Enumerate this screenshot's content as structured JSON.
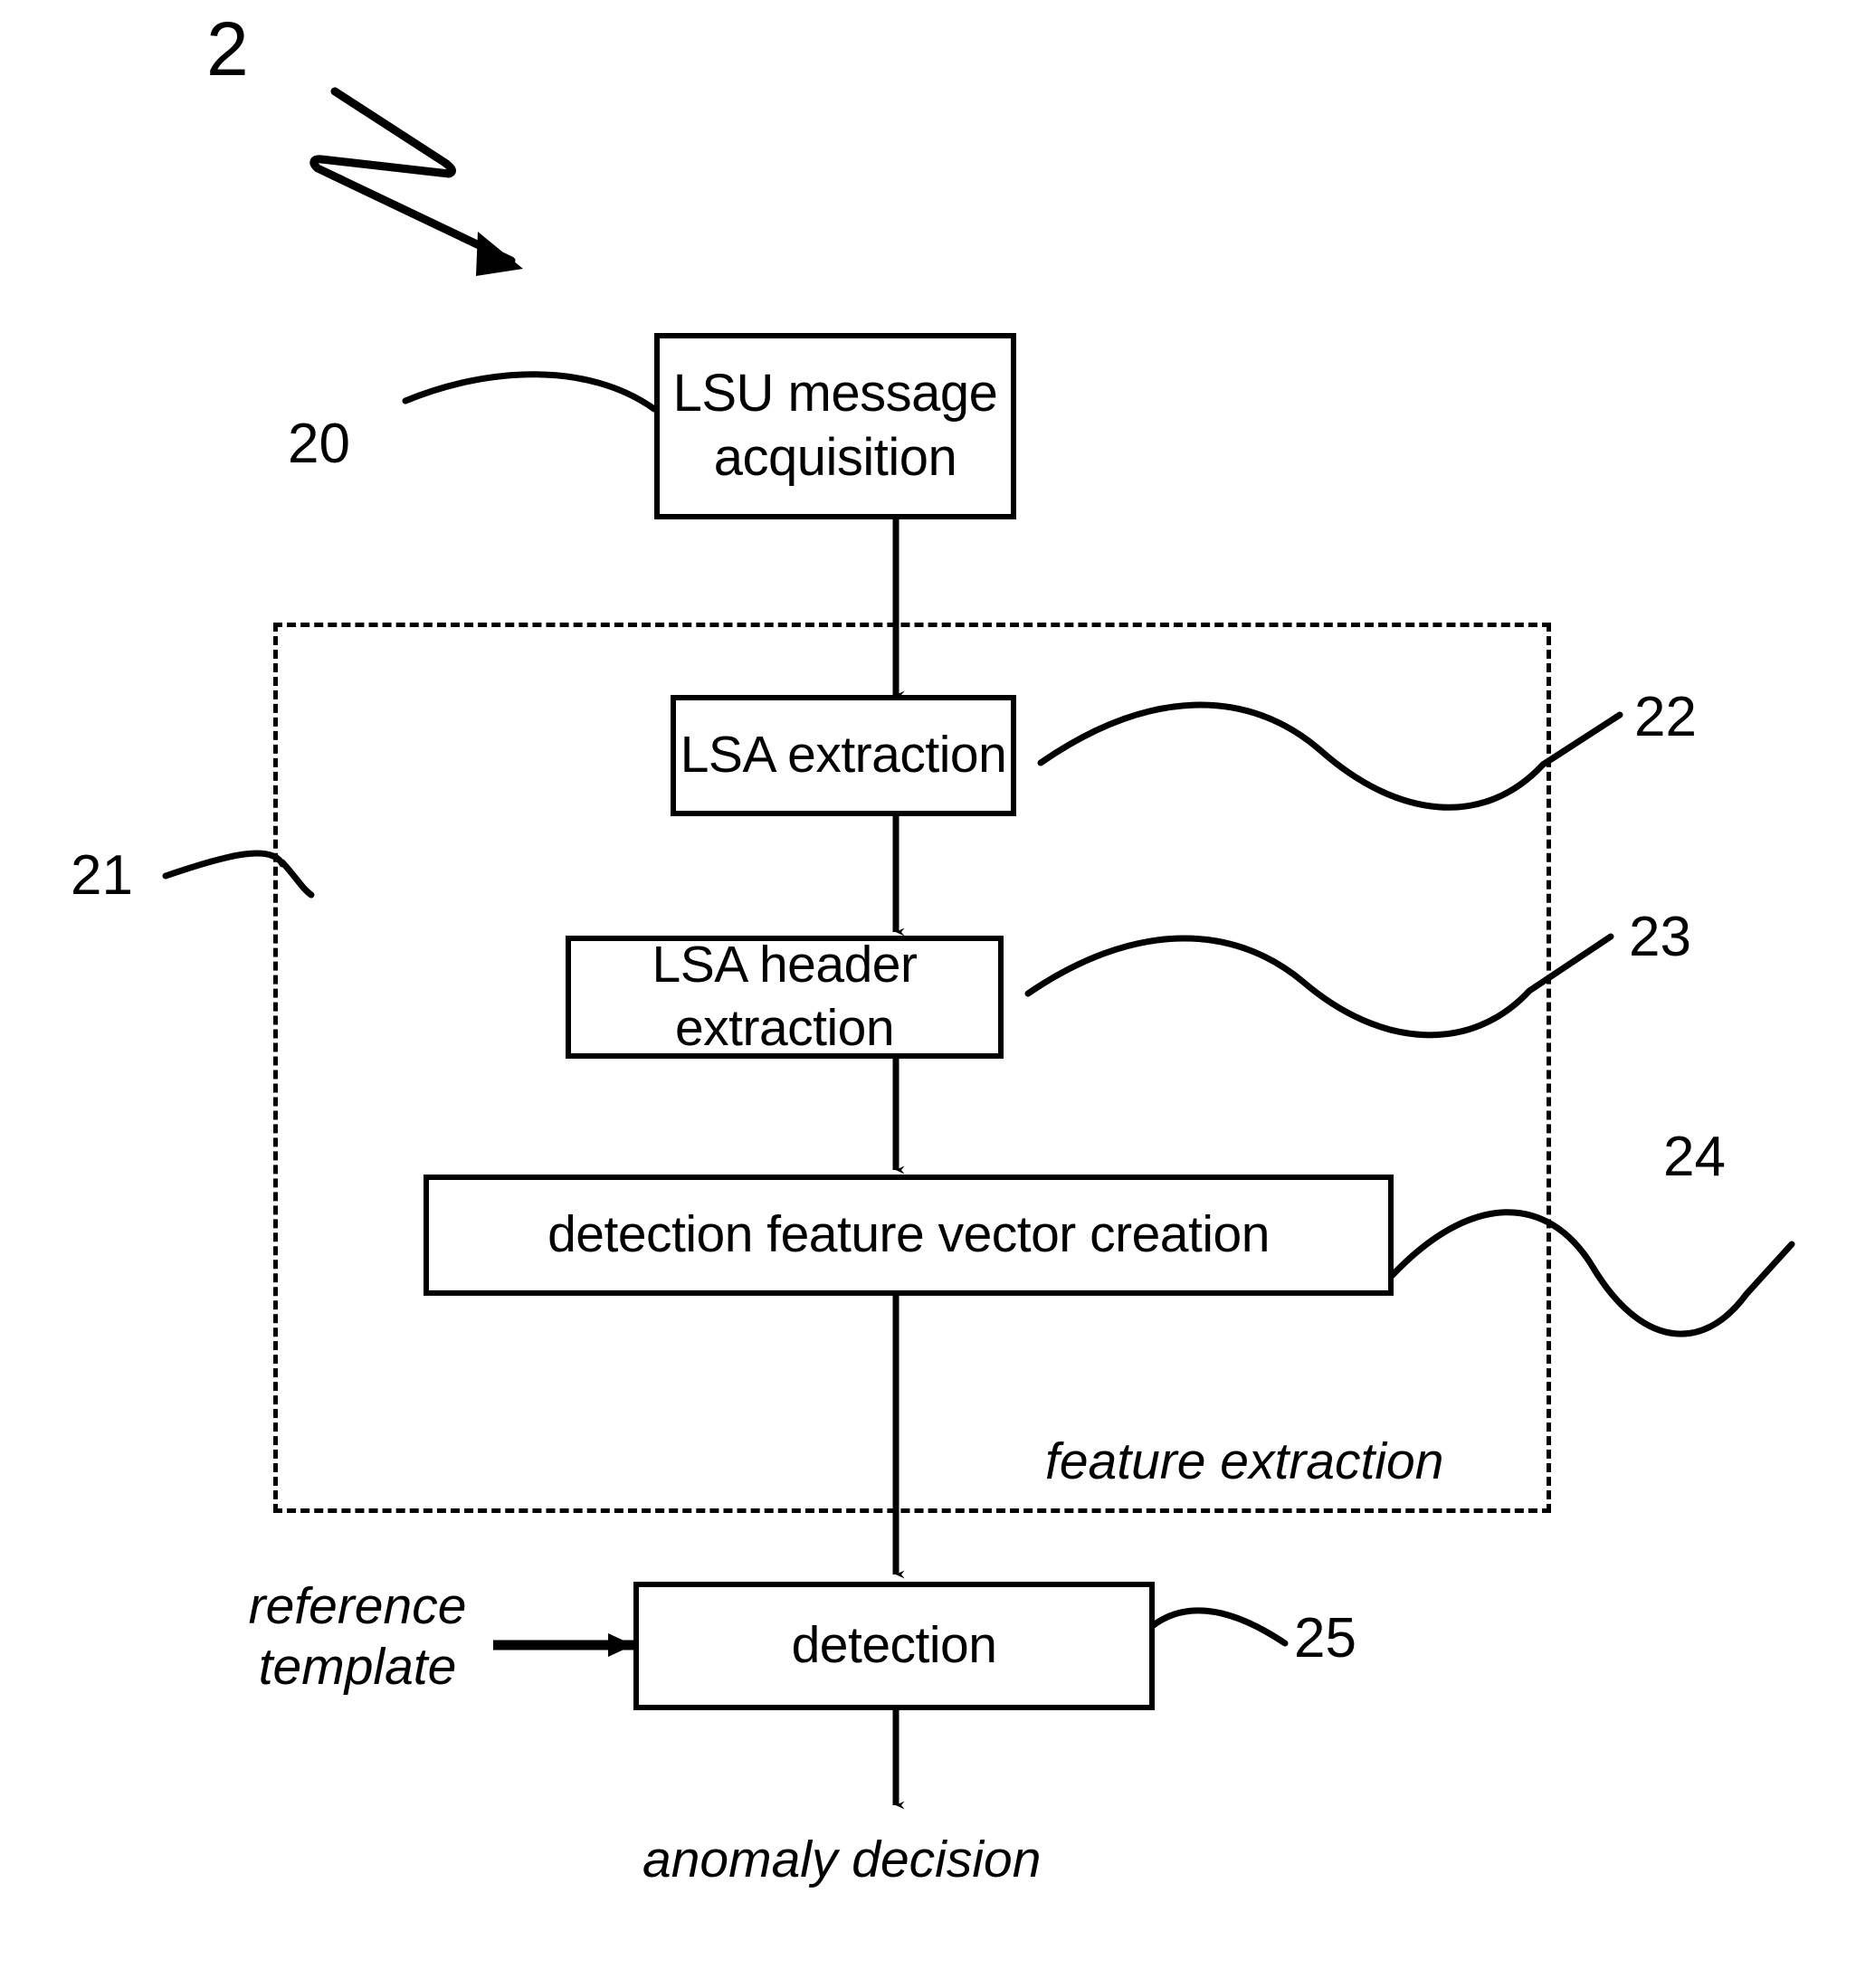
{
  "figure": {
    "label": "2",
    "type": "flowchart",
    "title_number": "2"
  },
  "nodes": [
    {
      "id": "acquisition",
      "lines": [
        "LSU message",
        "acquisition"
      ],
      "ref": "20"
    },
    {
      "id": "lsa-extraction",
      "lines": [
        "LSA extraction"
      ],
      "ref": "22"
    },
    {
      "id": "lsa-header-extraction",
      "lines": [
        "LSA header extraction"
      ],
      "ref": "23"
    },
    {
      "id": "feature-vector-creation",
      "lines": [
        "detection feature vector creation"
      ],
      "ref": "24"
    },
    {
      "id": "detection",
      "lines": [
        "detection"
      ],
      "ref": "25"
    }
  ],
  "group": {
    "id": "feature-extraction-group",
    "caption": "feature extraction",
    "ref": "21"
  },
  "annotations": {
    "reference_template_line1": "reference",
    "reference_template_line2": "template",
    "anomaly_decision": "anomaly decision"
  },
  "ref_numbers": {
    "fig": "2",
    "acquisition": "20",
    "group": "21",
    "lsa_extraction": "22",
    "lsa_header_extraction": "23",
    "feature_vector_creation": "24",
    "detection": "25"
  },
  "colors": {
    "ink": "#000000",
    "paper": "#ffffff"
  }
}
